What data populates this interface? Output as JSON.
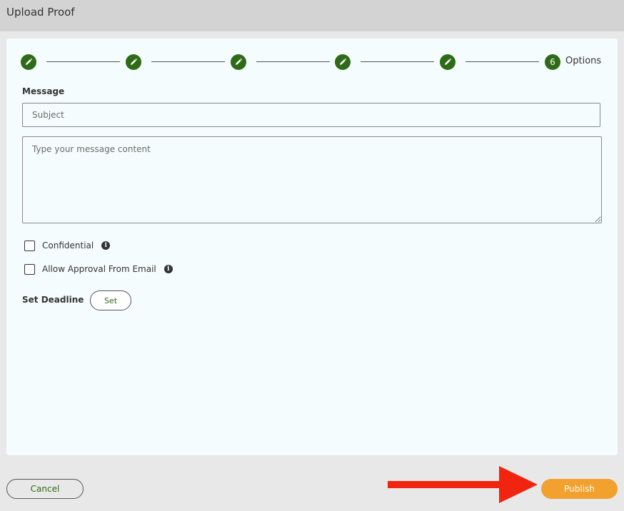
{
  "window": {
    "title": "Upload Proof"
  },
  "stepper": {
    "completed_icon": "pencil-icon",
    "current_step_number": "6",
    "current_step_label": "Options"
  },
  "message": {
    "label": "Message",
    "subject_placeholder": "Subject",
    "subject_value": "",
    "content_placeholder": "Type your message content",
    "content_value": ""
  },
  "options": {
    "confidential_label": "Confidential",
    "confidential_checked": false,
    "allow_email_label": "Allow Approval From Email",
    "allow_email_checked": false,
    "info_icon": "info-icon"
  },
  "deadline": {
    "label": "Set Deadline",
    "button_label": "Set"
  },
  "footer": {
    "cancel_label": "Cancel",
    "publish_label": "Publish"
  },
  "colors": {
    "brand_green": "#2e6a18",
    "publish_orange": "#f2a12e",
    "annotation_red": "#f0240f"
  }
}
